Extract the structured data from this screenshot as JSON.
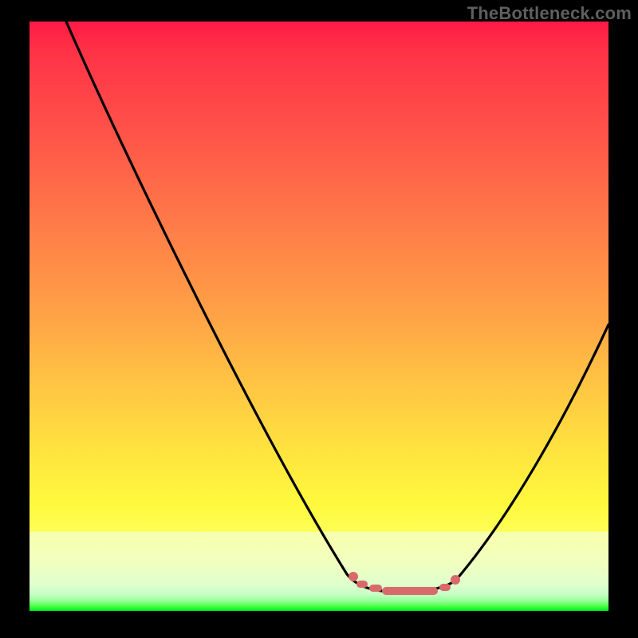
{
  "attribution": {
    "text": "TheBottleneck.com"
  },
  "chart_data": {
    "type": "line",
    "title": "",
    "xlabel": "",
    "ylabel": "",
    "xlim": [
      0,
      1
    ],
    "ylim": [
      0,
      1
    ],
    "x": [
      0.06,
      0.12,
      0.2,
      0.28,
      0.36,
      0.44,
      0.52,
      0.58,
      0.62,
      0.66,
      0.7,
      0.76,
      0.84,
      0.92,
      1.0
    ],
    "values": [
      1.0,
      0.86,
      0.72,
      0.58,
      0.44,
      0.3,
      0.16,
      0.08,
      0.04,
      0.03,
      0.04,
      0.1,
      0.24,
      0.38,
      0.5
    ],
    "series": [
      {
        "name": "bottleneck-curve",
        "color": "#000000",
        "x": [
          0.06,
          0.12,
          0.2,
          0.28,
          0.36,
          0.44,
          0.52,
          0.58,
          0.62,
          0.66,
          0.7,
          0.76,
          0.84,
          0.92,
          1.0
        ],
        "y": [
          1.0,
          0.86,
          0.72,
          0.58,
          0.44,
          0.3,
          0.16,
          0.08,
          0.04,
          0.03,
          0.04,
          0.1,
          0.24,
          0.38,
          0.5
        ]
      }
    ],
    "annotations": [
      {
        "name": "sweet-spot",
        "color": "#d86a6a",
        "x_range": [
          0.55,
          0.73
        ],
        "y": 0.03
      }
    ],
    "background_gradient": {
      "direction": "vertical",
      "stops": [
        {
          "pos": 0.0,
          "color": "#ff1a45"
        },
        {
          "pos": 0.34,
          "color": "#ff7a48"
        },
        {
          "pos": 0.62,
          "color": "#ffc643"
        },
        {
          "pos": 0.82,
          "color": "#fff93d"
        },
        {
          "pos": 0.87,
          "color": "#f7ffae"
        },
        {
          "pos": 0.97,
          "color": "#c6ffc6"
        },
        {
          "pos": 1.0,
          "color": "#00e53f"
        }
      ]
    }
  }
}
